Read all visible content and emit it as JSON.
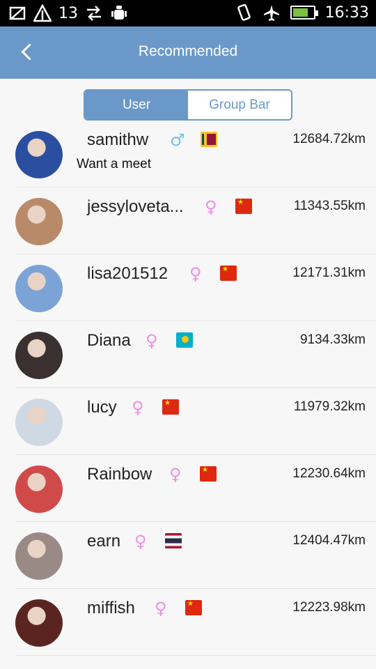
{
  "status_bar": {
    "signal_number": "13",
    "time": "16:33"
  },
  "header": {
    "title": "Recommended"
  },
  "segment": {
    "tabs": [
      {
        "label": "User",
        "active": true
      },
      {
        "label": "Group Bar",
        "active": false
      }
    ]
  },
  "users": [
    {
      "name": "samithw",
      "subtitle": "Want a meet",
      "gender": "male",
      "flag": "lk",
      "distance": "12684.72km",
      "avatar_color": "#2b4fa0"
    },
    {
      "name": "jessyloveta...",
      "subtitle": "",
      "gender": "female",
      "flag": "cn",
      "distance": "11343.55km",
      "avatar_color": "#b98a6a"
    },
    {
      "name": "lisa201512",
      "subtitle": "",
      "gender": "female",
      "flag": "cn",
      "distance": "12171.31km",
      "avatar_color": "#7ba3d6"
    },
    {
      "name": "Diana",
      "subtitle": "",
      "gender": "female",
      "flag": "kz",
      "distance": "9134.33km",
      "avatar_color": "#3a3030"
    },
    {
      "name": "lucy",
      "subtitle": "",
      "gender": "female",
      "flag": "cn",
      "distance": "11979.32km",
      "avatar_color": "#cfd9e3"
    },
    {
      "name": "Rainbow",
      "subtitle": "",
      "gender": "female",
      "flag": "cn",
      "distance": "12230.64km",
      "avatar_color": "#d04a4a"
    },
    {
      "name": "earn",
      "subtitle": "",
      "gender": "female",
      "flag": "th",
      "distance": "12404.47km",
      "avatar_color": "#9a8a85"
    },
    {
      "name": "miffish",
      "subtitle": "",
      "gender": "female",
      "flag": "cn",
      "distance": "12223.98km",
      "avatar_color": "#5a2520"
    }
  ]
}
